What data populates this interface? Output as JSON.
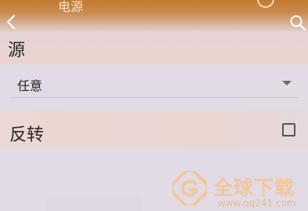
{
  "topbar": {
    "title": "电源"
  },
  "source": {
    "label": "源"
  },
  "select": {
    "value": "任意"
  },
  "toggle": {
    "label": "反转",
    "checked": false
  },
  "watermark": {
    "text": "全球下载",
    "url": "www.qq241.com"
  },
  "colors": {
    "accent": "#c27a2f",
    "background": "#e2dae4",
    "row": "#ebd7d3"
  }
}
